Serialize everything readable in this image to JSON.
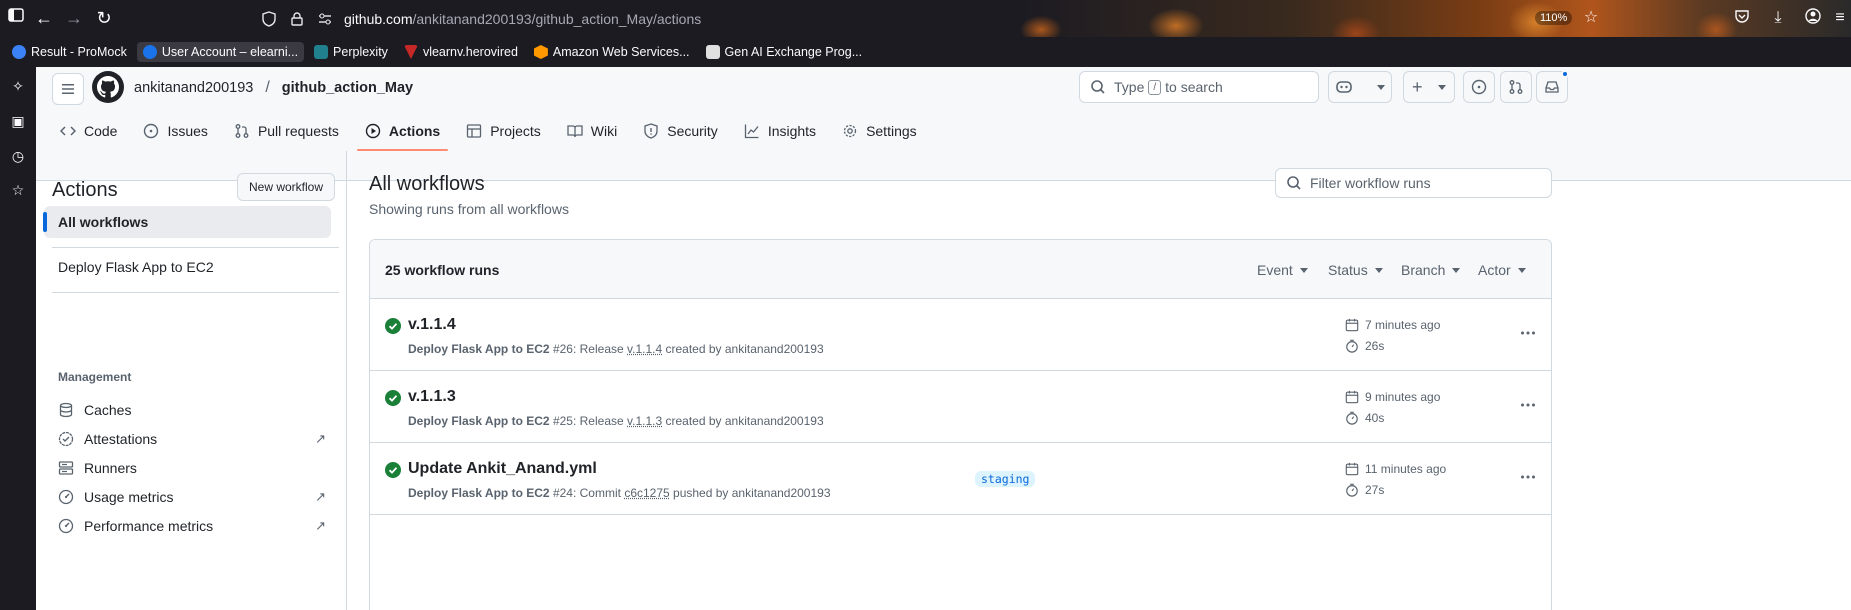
{
  "browser": {
    "url_domain": "github.com",
    "url_path": "/ankitanand200193/github_action_May/actions",
    "zoom": "110%",
    "bookmarks": [
      {
        "label": "Result - ProMock",
        "color": "#3b82f6",
        "active": false
      },
      {
        "label": "User Account – elearni...",
        "color": "#1a73e8",
        "active": true
      },
      {
        "label": "Perplexity",
        "color": "#20808d",
        "active": false
      },
      {
        "label": "vlearnv.herovired",
        "color": "#c62828",
        "active": false
      },
      {
        "label": "Amazon Web Services...",
        "color": "#ff9900",
        "active": false
      },
      {
        "label": "Gen AI Exchange Prog...",
        "color": "#e0e0e0",
        "active": false
      }
    ]
  },
  "header": {
    "owner": "ankitanand200193",
    "separator": "/",
    "repo": "github_action_May",
    "search_prefix": "Type",
    "search_key": "/",
    "search_suffix": "to search"
  },
  "tabs": [
    {
      "label": "Code",
      "icon": "code-icon"
    },
    {
      "label": "Issues",
      "icon": "issue-icon"
    },
    {
      "label": "Pull requests",
      "icon": "pull-request-icon"
    },
    {
      "label": "Actions",
      "icon": "play-icon",
      "active": true
    },
    {
      "label": "Projects",
      "icon": "table-icon"
    },
    {
      "label": "Wiki",
      "icon": "book-icon"
    },
    {
      "label": "Security",
      "icon": "shield-icon"
    },
    {
      "label": "Insights",
      "icon": "graph-icon"
    },
    {
      "label": "Settings",
      "icon": "gear-icon"
    }
  ],
  "sidebar": {
    "title": "Actions",
    "new_workflow": "New workflow",
    "all_workflows": "All workflows",
    "workflow": "Deploy Flask App to EC2",
    "management_heading": "Management",
    "management": [
      {
        "label": "Caches",
        "icon": "database-icon"
      },
      {
        "label": "Attestations",
        "icon": "verified-icon",
        "external": true
      },
      {
        "label": "Runners",
        "icon": "server-icon"
      },
      {
        "label": "Usage metrics",
        "icon": "meter-icon",
        "external": true
      },
      {
        "label": "Performance metrics",
        "icon": "meter-icon",
        "external": true
      }
    ],
    "external_glyph": "↗"
  },
  "main": {
    "title": "All workflows",
    "subtitle": "Showing runs from all workflows",
    "filter_placeholder": "Filter workflow runs",
    "runs_count": "25 workflow runs",
    "filters": [
      "Event",
      "Status",
      "Branch",
      "Actor"
    ],
    "runs": [
      {
        "title": "v.1.1.4",
        "workflow": "Deploy Flask App to EC2",
        "number": "#26",
        "action": ": Release",
        "ref": "v.1.1.4",
        "by": "created by ankitanand200193",
        "branch": "",
        "when": "7 minutes ago",
        "duration": "26s"
      },
      {
        "title": "v.1.1.3",
        "workflow": "Deploy Flask App to EC2",
        "number": "#25",
        "action": ": Release",
        "ref": "v.1.1.3",
        "by": "created by ankitanand200193",
        "branch": "",
        "when": "9 minutes ago",
        "duration": "40s"
      },
      {
        "title": "Update Ankit_Anand.yml",
        "workflow": "Deploy Flask App to EC2",
        "number": "#24",
        "action": ": Commit",
        "ref": "c6c1275",
        "by": "pushed by ankitanand200193",
        "branch": "staging",
        "when": "11 minutes ago",
        "duration": "27s"
      }
    ]
  }
}
